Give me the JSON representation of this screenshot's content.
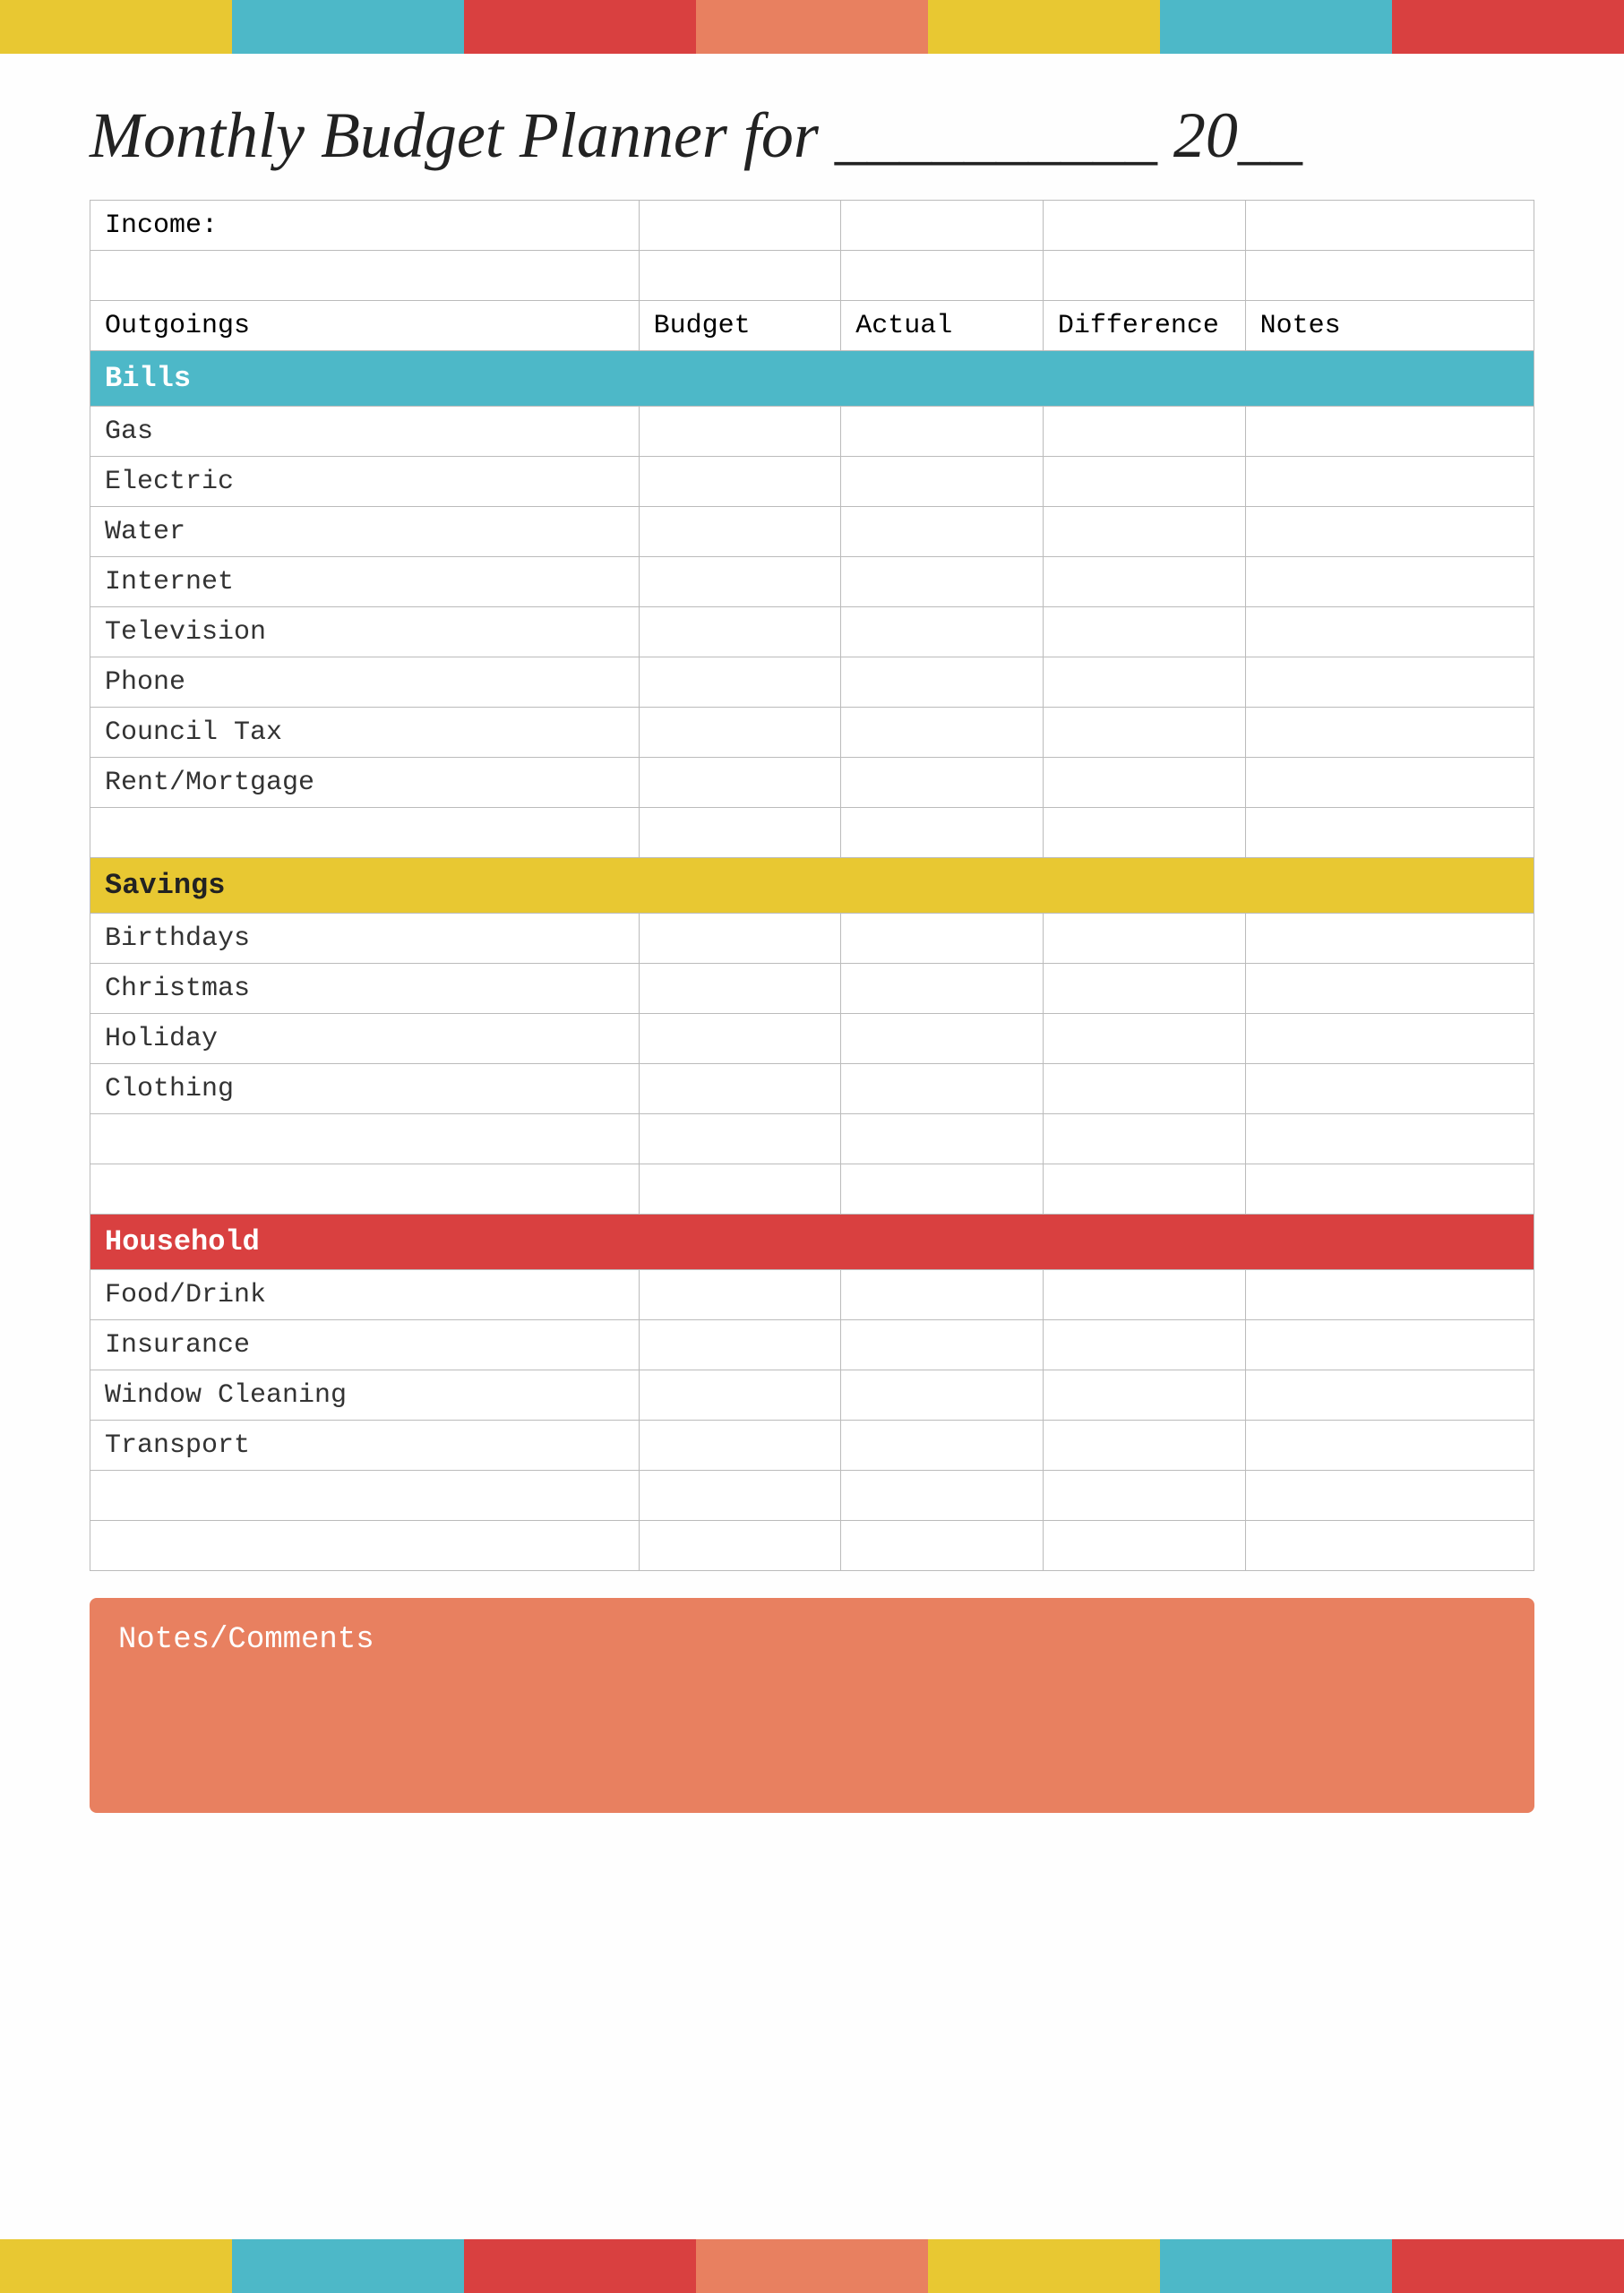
{
  "topBar": {
    "segments": [
      {
        "color": "bar-yellow",
        "name": "yellow-1"
      },
      {
        "color": "bar-teal",
        "name": "teal-1"
      },
      {
        "color": "bar-red",
        "name": "red-1"
      },
      {
        "color": "bar-salmon",
        "name": "salmon-1"
      },
      {
        "color": "bar-yellow2",
        "name": "yellow-2"
      },
      {
        "color": "bar-teal2",
        "name": "teal-2"
      },
      {
        "color": "bar-red2",
        "name": "red-2"
      }
    ]
  },
  "title": {
    "prefix": "Monthly Budget Planner for",
    "line1": "Monthly Budget Planner for __________ 20__"
  },
  "table": {
    "incomeLabel": "Income:",
    "columns": {
      "outgoings": "Outgoings",
      "budget": "Budget",
      "actual": "Actual",
      "difference": "Difference",
      "notes": "Notes"
    },
    "sections": {
      "bills": {
        "label": "Bills",
        "items": [
          "Gas",
          "Electric",
          "Water",
          "Internet",
          "Television",
          "Phone",
          "Council Tax",
          "Rent/Mortgage"
        ]
      },
      "savings": {
        "label": "Savings",
        "items": [
          "Birthdays",
          "Christmas",
          "Holiday",
          "Clothing"
        ]
      },
      "household": {
        "label": "Household",
        "items": [
          "Food/Drink",
          "Insurance",
          "Window Cleaning",
          "Transport"
        ]
      }
    }
  },
  "notes": {
    "label": "Notes/Comments"
  },
  "bottomBar": {
    "segments": [
      {
        "color": "bar-yellow",
        "name": "yellow-b1"
      },
      {
        "color": "bar-teal",
        "name": "teal-b1"
      },
      {
        "color": "bar-red",
        "name": "red-b1"
      },
      {
        "color": "bar-salmon",
        "name": "salmon-b1"
      },
      {
        "color": "bar-yellow2",
        "name": "yellow-b2"
      },
      {
        "color": "bar-teal2",
        "name": "teal-b2"
      },
      {
        "color": "bar-red2",
        "name": "red-b2"
      }
    ]
  }
}
